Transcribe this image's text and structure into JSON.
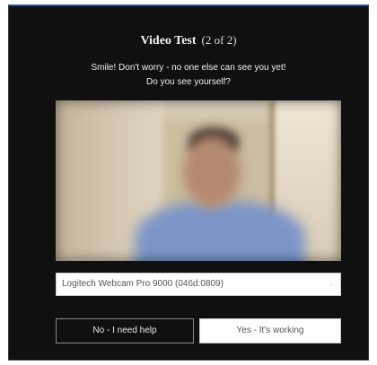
{
  "dialog": {
    "title": "Video Test",
    "step": "(2 of 2)",
    "subtitle_line1": "Smile! Don't worry - no one else can see you yet!",
    "subtitle_line2": "Do you see yourself?"
  },
  "camera_select": {
    "selected": "Logitech Webcam Pro 9000 (046d:0809)",
    "arrow_icon": "dropdown-arrow-icon"
  },
  "buttons": {
    "no_label": "No - I need help",
    "yes_label": "Yes - It's working"
  },
  "colors": {
    "dialog_bg": "#101010",
    "accent_border": "#2a4fa8",
    "yes_button_bg": "#ffffff"
  }
}
